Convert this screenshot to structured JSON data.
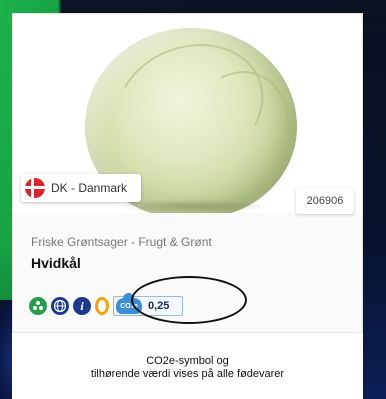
{
  "product": {
    "country": "DK - Danmark",
    "code": "206906",
    "category": "Friske Grøntsager - Frugt & Grønt",
    "name": "Hvidkål",
    "co2_symbol": "CO₂e",
    "co2_value": "0,25",
    "info_glyph": "i"
  },
  "icons": [
    "flag-denmark-icon",
    "recycle-icon",
    "globe-icon",
    "info-icon",
    "ring-icon",
    "co2-cloud-icon"
  ],
  "caption": {
    "line1": "CO2e-symbol og",
    "line2": "tilhørende værdi vises på alle fødevarer"
  },
  "colors": {
    "green_accent": "#1db14a",
    "dark_bg": "#050a18",
    "co2_blue": "#3d8ed8",
    "flag_red": "#d8262f"
  }
}
